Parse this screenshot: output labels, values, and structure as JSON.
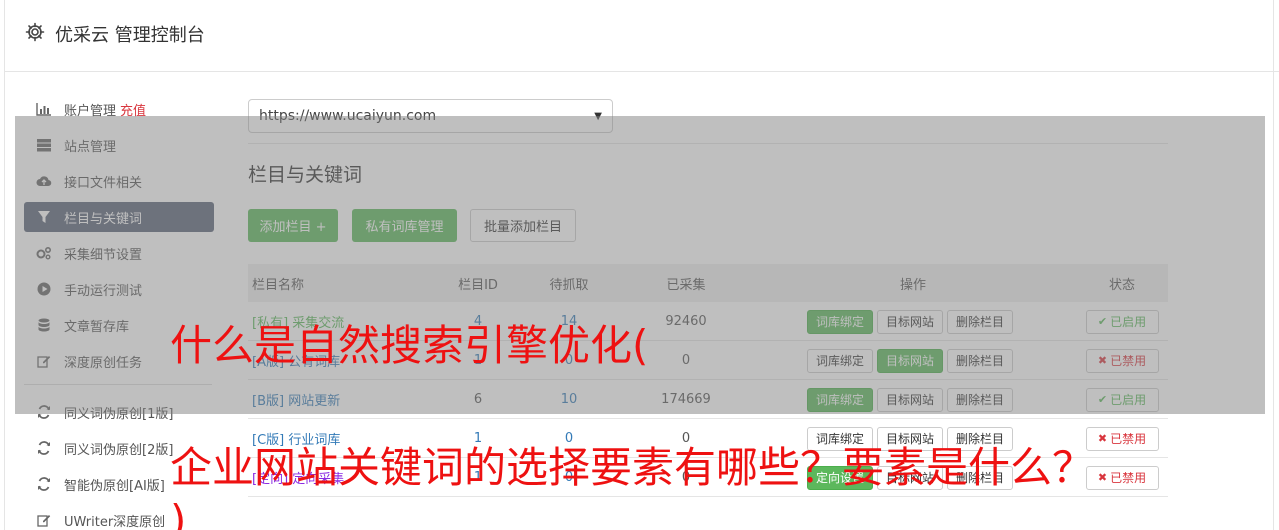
{
  "header": {
    "title": "优采云 管理控制台",
    "icon": "gear-icon"
  },
  "sidebar": {
    "items": [
      {
        "label": "账户管理",
        "badge": "充值",
        "icon": "bar-chart-icon"
      },
      {
        "label": "站点管理",
        "icon": "server-icon"
      },
      {
        "label": "接口文件相关",
        "icon": "cloud-upload-icon"
      },
      {
        "label": "栏目与关键词",
        "icon": "filter-icon",
        "active": true
      },
      {
        "label": "采集细节设置",
        "icon": "cogs-icon"
      },
      {
        "label": "手动运行测试",
        "icon": "play-circle-icon"
      },
      {
        "label": "文章暂存库",
        "icon": "database-icon"
      },
      {
        "label": "深度原创任务",
        "icon": "edit-icon"
      }
    ],
    "items2": [
      {
        "label": "同义词伪原创[1版]",
        "icon": "refresh-icon"
      },
      {
        "label": "同义词伪原创[2版]",
        "icon": "refresh-icon"
      },
      {
        "label": "智能伪原创[AI版]",
        "icon": "refresh-icon"
      },
      {
        "label": "UWriter深度原创",
        "icon": "edit-icon"
      }
    ]
  },
  "main": {
    "site_select": {
      "value": "https://www.ucaiyun.com"
    },
    "section_title": "栏目与关键词",
    "buttons": {
      "add": "添加栏目 +",
      "private_lib": "私有词库管理",
      "batch_add": "批量添加栏目"
    },
    "table": {
      "headers": {
        "name": "栏目名称",
        "id": "栏目ID",
        "pending": "待抓取",
        "collected": "已采集",
        "ops": "操作",
        "status": "状态"
      },
      "op_labels": {
        "bind": "词库绑定",
        "target": "目标网站",
        "delete": "删除栏目",
        "directed": "定向设置"
      },
      "status_labels": {
        "on": "已启用",
        "off": "已禁用"
      },
      "rows": [
        {
          "name": "[私有] 采集交流",
          "id": "4",
          "pending": "14",
          "collected": "92460",
          "status": "已启用"
        },
        {
          "name": "[A版] 公有词库",
          "id": "1",
          "pending": "0",
          "collected": "0",
          "status": "已禁用"
        },
        {
          "name": "[B版] 网站更新",
          "id": "6",
          "pending": "10",
          "collected": "174669",
          "status": "已启用"
        },
        {
          "name": "[C版] 行业词库",
          "id": "1",
          "pending": "0",
          "collected": "0",
          "status": "已禁用"
        },
        {
          "name": "[定向] 定向采集",
          "id": "1",
          "pending": "0",
          "collected": "0",
          "status": "已禁用"
        }
      ]
    }
  },
  "watermark": {
    "line1": "什么是自然搜索引擎优化(",
    "line2": "企业网站关键词的选择要素有哪些？要素是什么？",
    "line3": ")"
  },
  "colors": {
    "green": "#5cb85c",
    "active_nav": "#5a6478",
    "red": "#ee1111",
    "overlay": "rgba(128,128,128,0.5)"
  }
}
